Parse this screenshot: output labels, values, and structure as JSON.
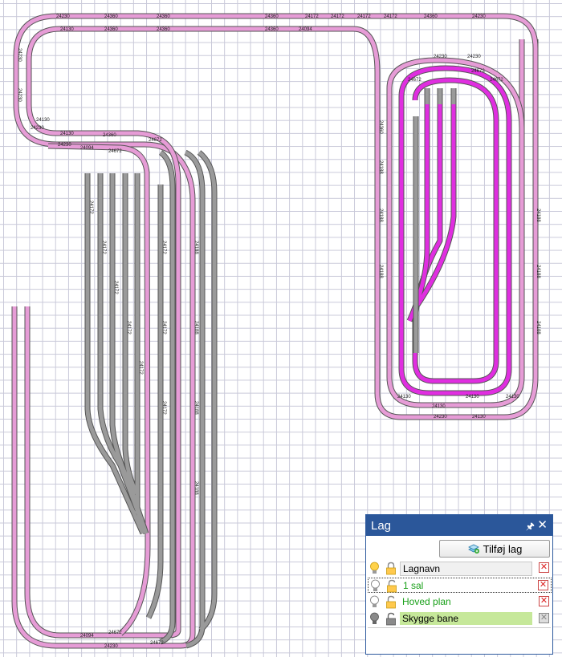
{
  "panel": {
    "title": "Lag",
    "add_button": "Tilføj lag",
    "header": "Lagnavn",
    "layers": [
      {
        "name": "1 sal",
        "color": "#19a019"
      },
      {
        "name": "Hoved plan",
        "color": "#19a019"
      },
      {
        "name": "Skygge bane",
        "highlight": "#c6e89a"
      }
    ]
  },
  "track_labels": {
    "top_a": "24360",
    "top_b": "24172",
    "top_c": "24230",
    "left_a": "24130",
    "left_b": "24230",
    "mid_a": "24094",
    "loop_a": "24188",
    "loop_b": "24130",
    "loop_c": "24672"
  },
  "colors": {
    "track_pink": "#e69cd6",
    "track_magenta": "#e02ee0",
    "track_gray": "#9a9a9a",
    "rail": "#555555",
    "grid": "#c9c9d9",
    "panel_header": "#2b579a"
  }
}
